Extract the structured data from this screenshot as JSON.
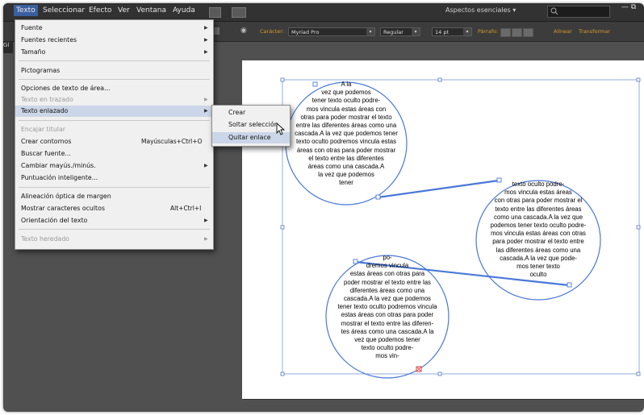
{
  "menubar": {
    "items": [
      "Texto",
      "Seleccionar",
      "Efecto",
      "Ver",
      "Ventana",
      "Ayuda"
    ],
    "workspace": "Aspectos esenciales",
    "workspace_arrow": "▾"
  },
  "controlbar": {
    "character_label": "Carácter:",
    "font_family": "Myriad Pro",
    "font_style": "Regular",
    "font_size": "14 pt",
    "paragraph_label": "Párrafo:",
    "align_label": "Alinear",
    "transform_label": "Transformar"
  },
  "texto_menu": {
    "items": [
      {
        "label": "Fuente",
        "submenu": true,
        "disabled": false
      },
      {
        "label": "Fuentes recientes",
        "submenu": true,
        "disabled": false
      },
      {
        "label": "Tamaño",
        "submenu": true,
        "disabled": false
      },
      {
        "label": "Pictogramas",
        "submenu": false,
        "disabled": false
      },
      {
        "label": "Opciones de texto de área...",
        "submenu": false,
        "disabled": false
      },
      {
        "label": "Texto en trazado",
        "submenu": true,
        "disabled": true
      },
      {
        "label": "Texto enlazado",
        "submenu": true,
        "disabled": false,
        "highlighted": true
      },
      {
        "label": "Encajar titular",
        "submenu": false,
        "disabled": true
      },
      {
        "label": "Crear contornos",
        "shortcut": "Mayúsculas+Ctrl+O",
        "submenu": false,
        "disabled": false
      },
      {
        "label": "Buscar fuente...",
        "submenu": false,
        "disabled": false
      },
      {
        "label": "Cambiar mayús./minús.",
        "submenu": true,
        "disabled": false
      },
      {
        "label": "Puntuación inteligente...",
        "submenu": false,
        "disabled": false
      },
      {
        "label": "Alineación óptica de margen",
        "submenu": false,
        "disabled": false
      },
      {
        "label": "Mostrar caracteres ocultos",
        "shortcut": "Alt+Ctrl+I",
        "submenu": false,
        "disabled": false
      },
      {
        "label": "Orientación del texto",
        "submenu": true,
        "disabled": false
      },
      {
        "label": "Texto heredado",
        "submenu": true,
        "disabled": true
      }
    ],
    "submenu_arrow": "▶"
  },
  "threaded_submenu": {
    "items": [
      {
        "label": "Crear",
        "highlighted": false
      },
      {
        "label": "Soltar selección",
        "highlighted": false
      },
      {
        "label": "Quitar enlace",
        "highlighted": true
      }
    ]
  },
  "canvas": {
    "circle1": [
      "A la",
      "vez que podemos",
      "tener texto oculto podre-",
      "mos vincula estas áreas con",
      "otras para poder mostrar el texto",
      "entre las diferentes áreas como una",
      "cascada.A la vez que podemos tener",
      "texto oculto podremos vincula estas",
      "áreas con otras para poder mostrar",
      "el texto entre las diferentes",
      "áreas como una cascada.A",
      "la vez que podemos",
      "tener"
    ],
    "circle2": [
      "texto oculto podre-",
      "mos vincula estas áreas",
      "con otras para poder mostrar el",
      "texto entre las diferentes áreas",
      "como una cascada.A la vez que",
      "podemos tener texto oculto podre-",
      "mos vincula estas áreas con otras",
      "para poder mostrar el texto entre",
      "las diferentes áreas como una",
      "cascada.A la vez que pode-",
      "mos tener texto",
      "oculto"
    ],
    "circle3": [
      "po-",
      "dremos vincula",
      "estas áreas con otras para",
      "poder mostrar el texto entre las",
      "diferentes áreas como una",
      "cascada.A la vez que podemos",
      "tener texto oculto podremos vincula",
      "estas áreas con otras para poder",
      "mostrar el texto entre las diferen-",
      "tes áreas como una cascada.A la",
      "vez que podemos tener",
      "texto oculto podre-",
      "mos vin-"
    ]
  }
}
